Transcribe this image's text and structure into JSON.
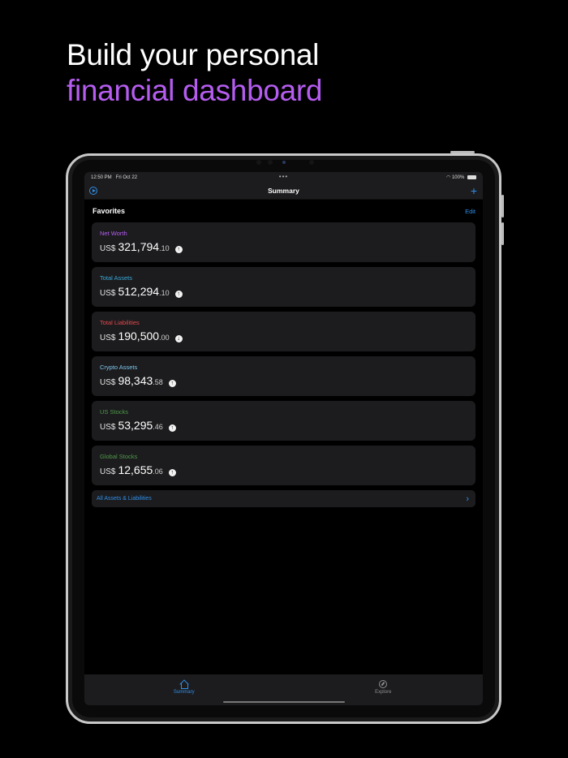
{
  "headline": {
    "line1": "Build your personal",
    "line2": "financial dashboard"
  },
  "status_bar": {
    "time": "12:50 PM",
    "date": "Fri Oct 22",
    "dots": "•••",
    "battery": "100%"
  },
  "nav": {
    "title": "Summary",
    "add_label": "+"
  },
  "favorites": {
    "label": "Favorites",
    "edit_label": "Edit",
    "cards": [
      {
        "name": "Net Worth",
        "color": "#b65df0",
        "currency": "US$",
        "whole": "321,794",
        "decimal": ".10",
        "trend": "up",
        "arrow": "↑"
      },
      {
        "name": "Total Assets",
        "color": "#3aa8d8",
        "currency": "US$",
        "whole": "512,294",
        "decimal": ".10",
        "trend": "up",
        "arrow": "↑"
      },
      {
        "name": "Total Liabilities",
        "color": "#e5484d",
        "currency": "US$",
        "whole": "190,500",
        "decimal": ".00",
        "trend": "down",
        "arrow": "↓"
      },
      {
        "name": "Crypto Assets",
        "color": "#7fc8f0",
        "currency": "US$",
        "whole": "98,343",
        "decimal": ".58",
        "trend": "up",
        "arrow": "↑"
      },
      {
        "name": "US Stocks",
        "color": "#4f9a4a",
        "currency": "US$",
        "whole": "53,295",
        "decimal": ".46",
        "trend": "up",
        "arrow": "↑"
      },
      {
        "name": "Global Stocks",
        "color": "#4f9a4a",
        "currency": "US$",
        "whole": "12,655",
        "decimal": ".06",
        "trend": "up",
        "arrow": "↑"
      }
    ]
  },
  "all_assets": {
    "label": "All Assets & Liabilities",
    "chevron": "›"
  },
  "tabbar": {
    "tabs": [
      {
        "label": "Summary",
        "icon": "home-icon",
        "active": true
      },
      {
        "label": "Explore",
        "icon": "compass-icon",
        "active": false
      }
    ]
  },
  "colors": {
    "accent": "#2f8fe8",
    "headline_highlight": "#b65df0",
    "card_bg": "#1c1c1e"
  }
}
